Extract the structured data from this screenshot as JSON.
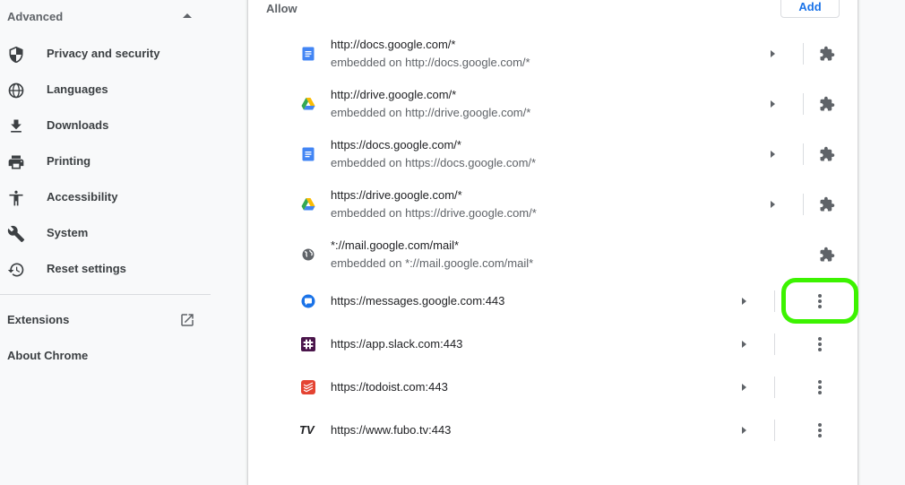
{
  "sidebar": {
    "advanced_label": "Advanced",
    "items": [
      {
        "label": "Privacy and security",
        "icon": "shield-icon"
      },
      {
        "label": "Languages",
        "icon": "globe-icon"
      },
      {
        "label": "Downloads",
        "icon": "download-icon"
      },
      {
        "label": "Printing",
        "icon": "printer-icon"
      },
      {
        "label": "Accessibility",
        "icon": "accessibility-icon"
      },
      {
        "label": "System",
        "icon": "wrench-icon"
      },
      {
        "label": "Reset settings",
        "icon": "restore-icon"
      }
    ],
    "extensions_label": "Extensions",
    "about_label": "About Chrome"
  },
  "main": {
    "section_title": "Allow",
    "add_button_label": "Add",
    "entries": [
      {
        "origin": "http://docs.google.com/*",
        "embedded": "embedded on http://docs.google.com/*",
        "icon": "google-docs-icon",
        "has_arrow": true,
        "action": "extension-puzzle-icon"
      },
      {
        "origin": "http://drive.google.com/*",
        "embedded": "embedded on http://drive.google.com/*",
        "icon": "google-drive-icon",
        "has_arrow": true,
        "action": "extension-puzzle-icon"
      },
      {
        "origin": "https://docs.google.com/*",
        "embedded": "embedded on https://docs.google.com/*",
        "icon": "google-docs-icon",
        "has_arrow": true,
        "action": "extension-puzzle-icon"
      },
      {
        "origin": "https://drive.google.com/*",
        "embedded": "embedded on https://drive.google.com/*",
        "icon": "google-drive-icon",
        "has_arrow": true,
        "action": "extension-puzzle-icon"
      },
      {
        "origin": "*://mail.google.com/mail*",
        "embedded": "embedded on *://mail.google.com/mail*",
        "icon": "globe-icon",
        "has_arrow": false,
        "action": "extension-puzzle-icon"
      },
      {
        "origin": "https://messages.google.com:443",
        "icon": "google-messages-icon",
        "has_arrow": true,
        "action": "more-vert-icon"
      },
      {
        "origin": "https://app.slack.com:443",
        "icon": "slack-icon",
        "has_arrow": true,
        "action": "more-vert-icon"
      },
      {
        "origin": "https://todoist.com:443",
        "icon": "todoist-icon",
        "has_arrow": true,
        "action": "more-vert-icon"
      },
      {
        "origin": "https://www.fubo.tv:443",
        "icon": "fubo-tv-icon",
        "icon_text": "TV",
        "has_arrow": true,
        "action": "more-vert-icon"
      }
    ]
  },
  "colors": {
    "accent": "#1a73e8",
    "highlight": "#3cf300",
    "docs_blue": "#4285f4",
    "todoist_red": "#e44332",
    "slack_purple": "#4a154b"
  }
}
